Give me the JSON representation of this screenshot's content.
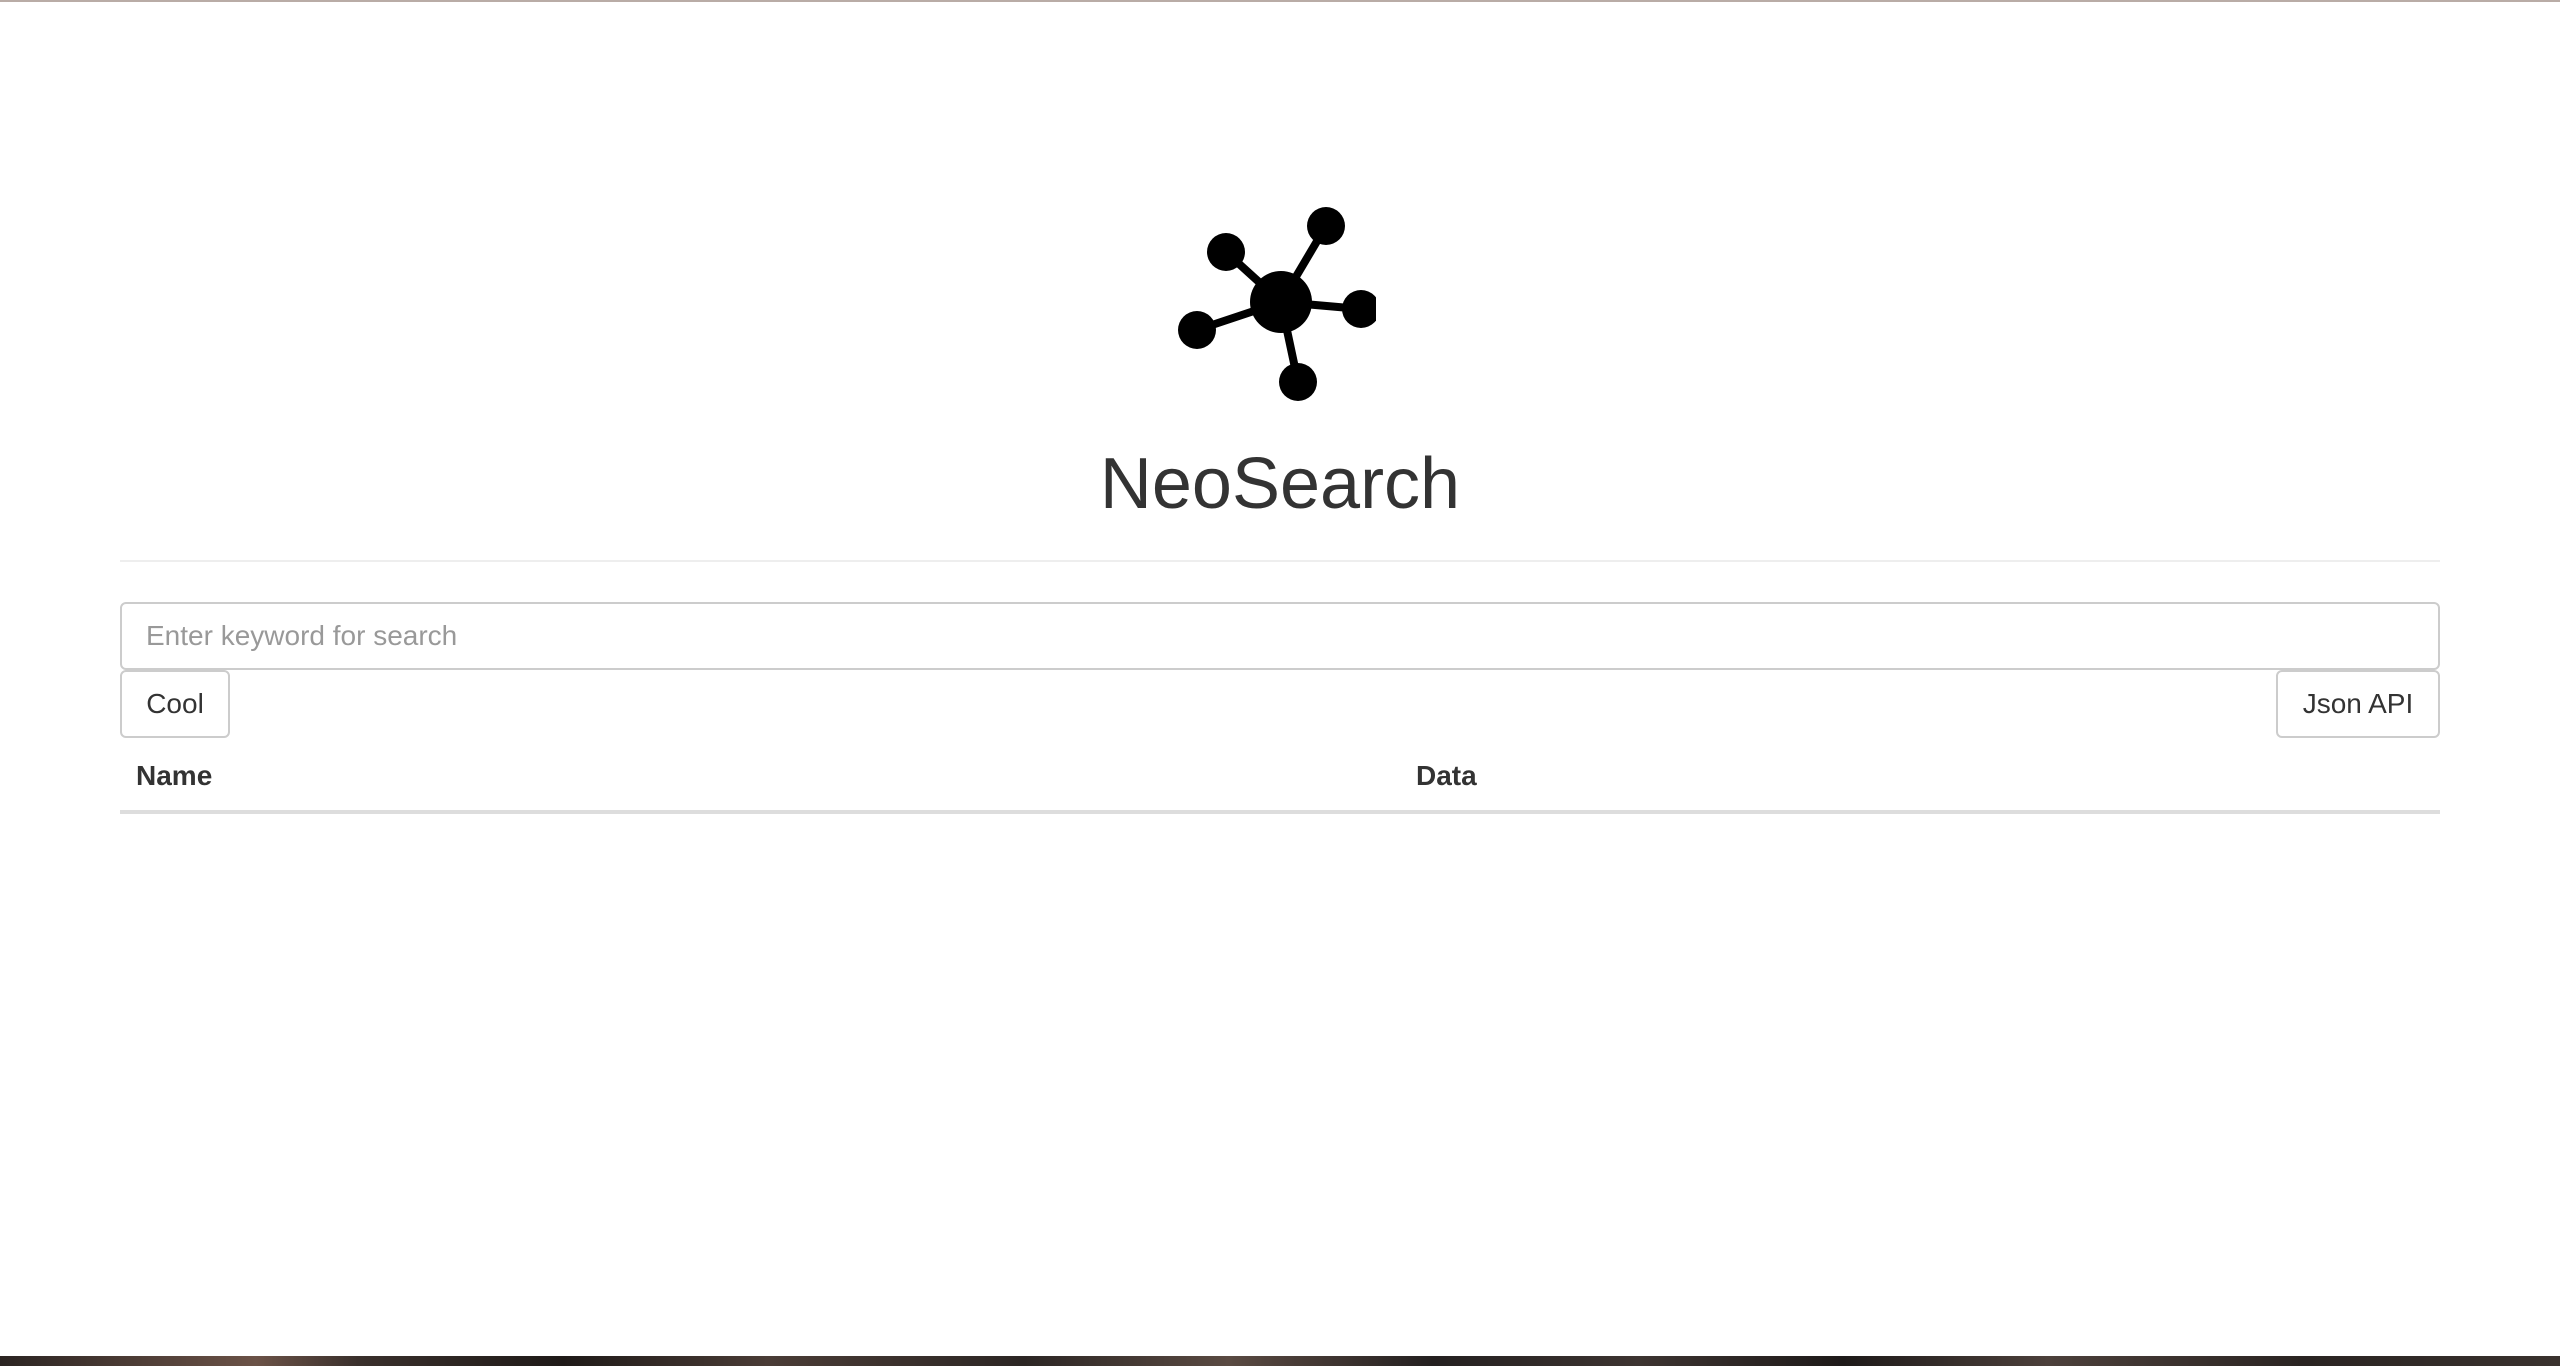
{
  "app": {
    "title": "NeoSearch",
    "logo_icon": "graph-network-icon"
  },
  "search": {
    "placeholder": "Enter keyword for search",
    "value": ""
  },
  "actions": {
    "cool_label": "Cool",
    "json_api_label": "Json API"
  },
  "results": {
    "columns": [
      "Name",
      "Data"
    ],
    "rows": []
  },
  "colors": {
    "text": "#333333",
    "border": "#cccccc",
    "divider": "#eeeeee",
    "placeholder": "#999999"
  }
}
